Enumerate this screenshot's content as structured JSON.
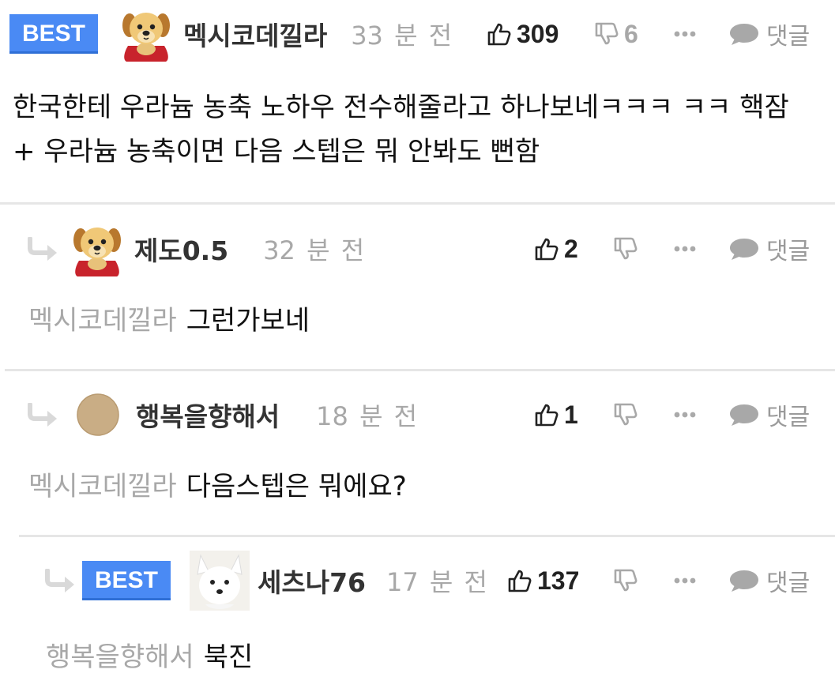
{
  "labels": {
    "best": "BEST",
    "reply": "댓글"
  },
  "comments": [
    {
      "nickname": "멕시코데낄라",
      "time": "33 분 전",
      "likes": "309",
      "dislikes": "6",
      "mention": "",
      "text": "한국한테 우라늄 농축 노하우 전수해줄라고 하나보네ㅋㅋㅋ ㅋㅋ 핵잠 + 우라늄 농축이면 다음 스텝은 뭐 안봐도 뻔함",
      "avatar": "puppy-avatar"
    },
    {
      "nickname": "제도0.5",
      "time": "32 분 전",
      "likes": "2",
      "dislikes": "",
      "mention": "멕시코데낄라",
      "text": "그런가보네",
      "avatar": "puppy-avatar"
    },
    {
      "nickname": "행복을향해서",
      "time": "18 분 전",
      "likes": "1",
      "dislikes": "",
      "mention": "멕시코데낄라",
      "text": "다음스텝은 뭐에요?",
      "avatar": "default-circle-avatar"
    },
    {
      "nickname": "세츠나76",
      "time": "17 분 전",
      "likes": "137",
      "dislikes": "",
      "mention": "행복을향해서",
      "text": "북진",
      "avatar": "white-fox-avatar"
    }
  ],
  "colors": {
    "best_badge": "#4a8af4",
    "muted": "#a8a8a8",
    "divider": "#e6e6e6"
  }
}
